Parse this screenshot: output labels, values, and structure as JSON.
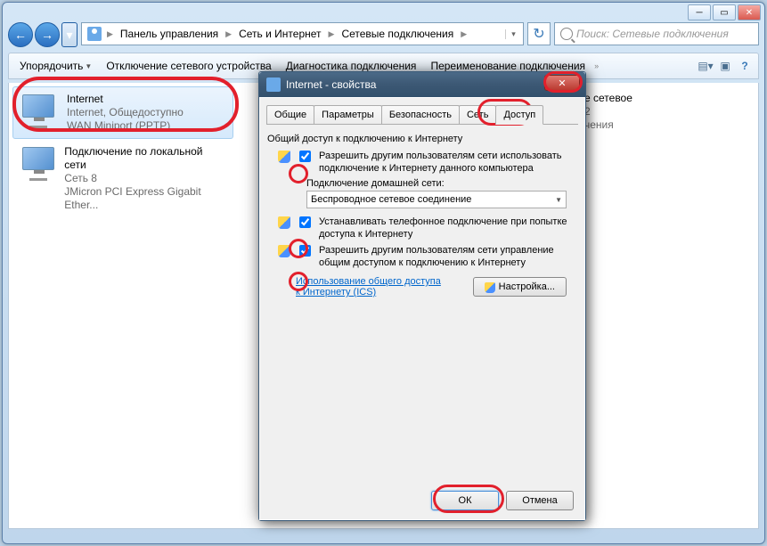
{
  "breadcrumb": {
    "seg1": "Панель управления",
    "seg2": "Сеть и Интернет",
    "seg3": "Сетевые подключения"
  },
  "search": {
    "placeholder": "Поиск: Сетевые подключения"
  },
  "toolbar": {
    "organize": "Упорядочить",
    "disable": "Отключение сетевого устройства",
    "diagnose": "Диагностика подключения",
    "rename": "Переименование подключения"
  },
  "conn1": {
    "name": "Internet",
    "line2": "Internet, Общедоступно",
    "line3": "WAN Miniport (PPTP)"
  },
  "conn2": {
    "name": "Подключение по локальной сети",
    "line2": "Сеть 8",
    "line3": "JMicron PCI Express Gigabit Ether..."
  },
  "conn3": {
    "name": "е сетевое",
    "line2": "2",
    "line3": "чения"
  },
  "dialog": {
    "title": "Internet - свойства",
    "tabs": {
      "general": "Общие",
      "params": "Параметры",
      "security": "Безопасность",
      "network": "Сеть",
      "sharing": "Доступ"
    },
    "group_label": "Общий доступ к подключению к Интернету",
    "chk1": "Разрешить другим пользователям сети использовать подключение к Интернету данного компьютера",
    "homenet_lbl": "Подключение домашней сети:",
    "homenet_sel": "Беспроводное сетевое соединение",
    "chk2": "Устанавливать телефонное подключение при попытке доступа к Интернету",
    "chk3": "Разрешить другим пользователям сети управление общим доступом к подключению к Интернету",
    "link": "Использование общего доступа к Интернету (ICS)",
    "settings_btn": "Настройка...",
    "ok": "ОК",
    "cancel": "Отмена"
  }
}
